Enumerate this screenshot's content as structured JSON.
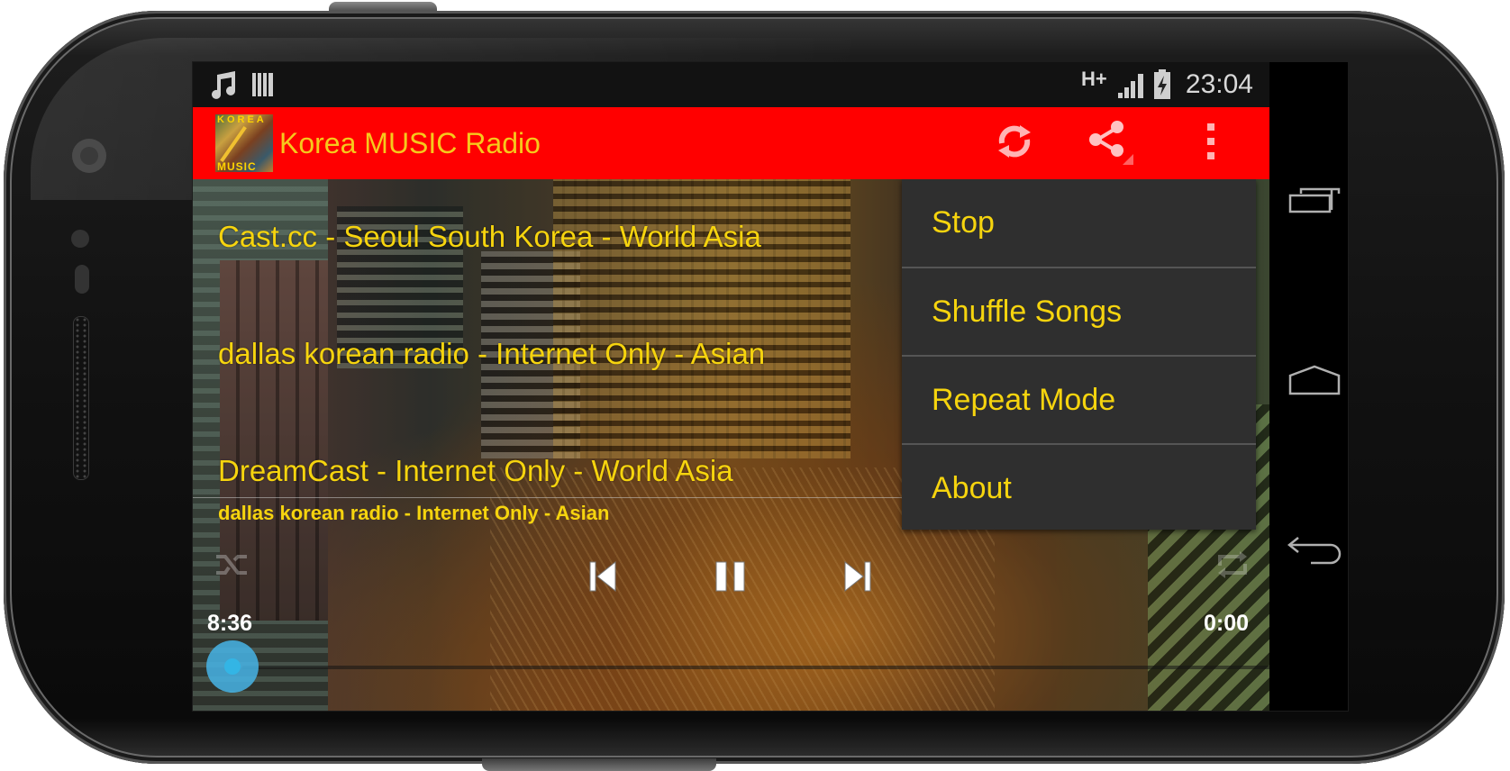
{
  "device": {
    "status_bar": {
      "notification_icons": [
        "music-note-icon",
        "barcode-icon"
      ],
      "network_type": "H+",
      "signal_icon": "signal-strength-icon",
      "battery_icon": "battery-charging-icon",
      "time": "23:04"
    },
    "nav_bar": {
      "buttons": [
        {
          "name": "recent-apps",
          "icon": "recent-apps-icon"
        },
        {
          "name": "home",
          "icon": "home-icon"
        },
        {
          "name": "back",
          "icon": "back-icon"
        }
      ]
    }
  },
  "app": {
    "title": "Korea MUSIC Radio",
    "icon_label_top": "KOREA",
    "icon_label_bottom": "MUSIC",
    "accent_color": "#ff0000",
    "text_color": "#f6d40e",
    "actions": [
      {
        "name": "refresh",
        "icon": "refresh-icon"
      },
      {
        "name": "share",
        "icon": "share-icon"
      },
      {
        "name": "overflow",
        "icon": "more-vertical-icon"
      }
    ]
  },
  "stations": [
    {
      "label": "Cast.cc  - Seoul South Korea - World Asia"
    },
    {
      "label": "dallas korean radio - Internet Only  - Asian"
    },
    {
      "label": "DreamCast  - Internet Only  - World Asia"
    }
  ],
  "player": {
    "now_playing": "dallas korean radio  -  Internet Only   -  Asian",
    "elapsed": "8:36",
    "remaining": "0:00",
    "progress_fraction": 0.0,
    "controls": [
      {
        "name": "shuffle",
        "icon": "shuffle-icon"
      },
      {
        "name": "previous",
        "icon": "skip-previous-icon"
      },
      {
        "name": "pause",
        "icon": "pause-icon"
      },
      {
        "name": "next",
        "icon": "skip-next-icon"
      },
      {
        "name": "repeat",
        "icon": "repeat-icon"
      }
    ],
    "seek_color": "#33b5e5"
  },
  "overflow_menu": {
    "items": [
      {
        "label": "Stop"
      },
      {
        "label": "Shuffle Songs"
      },
      {
        "label": "Repeat Mode"
      },
      {
        "label": "About"
      }
    ]
  }
}
